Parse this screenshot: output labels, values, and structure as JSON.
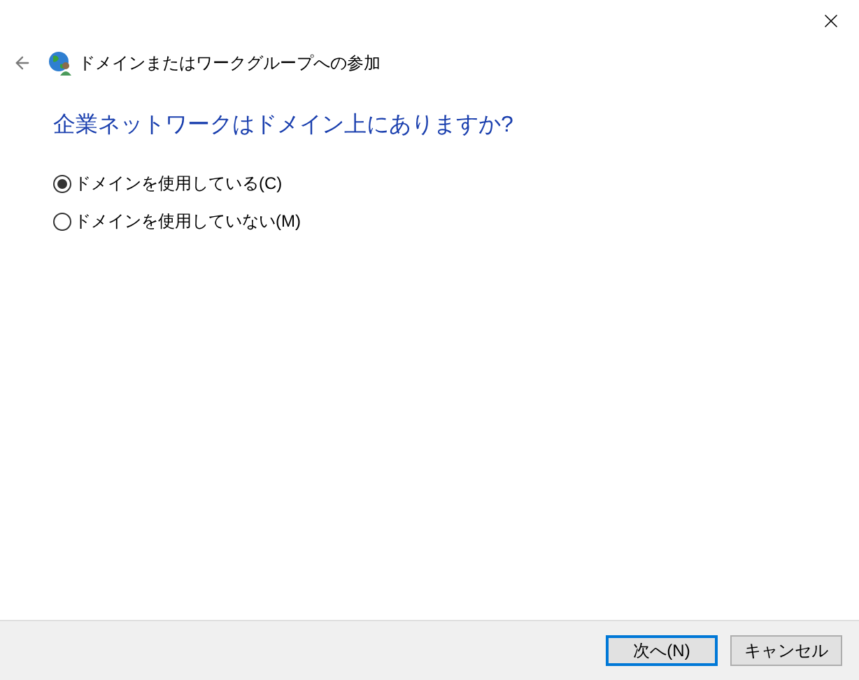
{
  "window": {
    "title": "ドメインまたはワークグループへの参加"
  },
  "heading": "企業ネットワークはドメイン上にありますか?",
  "options": [
    {
      "label": "ドメインを使用している(C)",
      "selected": true
    },
    {
      "label": "ドメインを使用していない(M)",
      "selected": false
    }
  ],
  "buttons": [
    {
      "label": "次へ(N)",
      "kind": "default"
    },
    {
      "label": "キャンセル",
      "kind": "normal"
    }
  ]
}
